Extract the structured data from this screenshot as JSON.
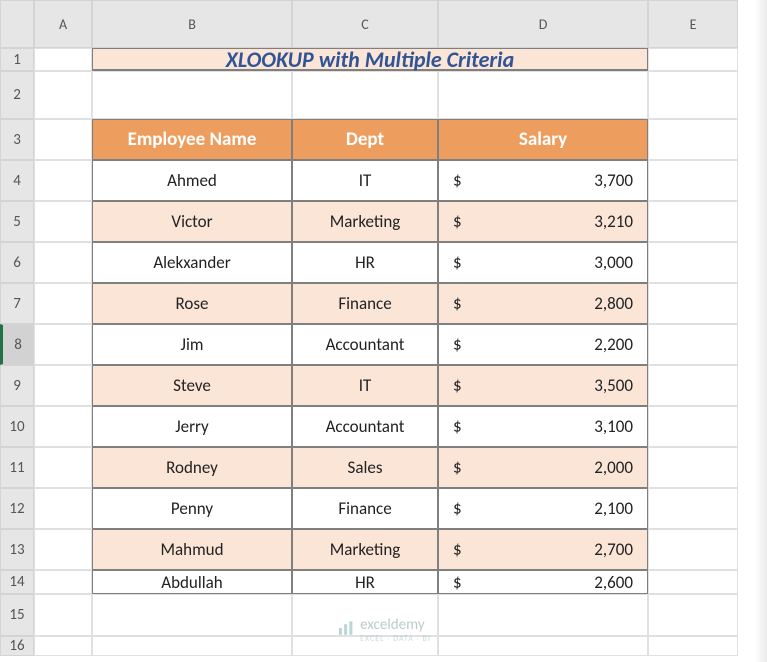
{
  "columns": [
    "A",
    "B",
    "C",
    "D",
    "E"
  ],
  "row_numbers": [
    1,
    2,
    3,
    4,
    5,
    6,
    7,
    8,
    9,
    10,
    11,
    12,
    13,
    14,
    15,
    16
  ],
  "selected_row": 8,
  "title": "XLOOKUP with Multiple Criteria",
  "headers": {
    "name": "Employee Name",
    "dept": "Dept",
    "salary": "Salary"
  },
  "currency": "$",
  "chart_data": {
    "type": "table",
    "columns": [
      "Employee Name",
      "Dept",
      "Salary"
    ],
    "rows": [
      {
        "name": "Ahmed",
        "dept": "IT",
        "salary": 3700,
        "salary_fmt": "3,700"
      },
      {
        "name": "Victor",
        "dept": "Marketing",
        "salary": 3210,
        "salary_fmt": "3,210"
      },
      {
        "name": "Alekxander",
        "dept": "HR",
        "salary": 3000,
        "salary_fmt": "3,000"
      },
      {
        "name": "Rose",
        "dept": "Finance",
        "salary": 2800,
        "salary_fmt": "2,800"
      },
      {
        "name": "Jim",
        "dept": "Accountant",
        "salary": 2200,
        "salary_fmt": "2,200"
      },
      {
        "name": "Steve",
        "dept": "IT",
        "salary": 3500,
        "salary_fmt": "3,500"
      },
      {
        "name": "Jerry",
        "dept": "Accountant",
        "salary": 3100,
        "salary_fmt": "3,100"
      },
      {
        "name": "Rodney",
        "dept": "Sales",
        "salary": 2000,
        "salary_fmt": "2,000"
      },
      {
        "name": "Penny",
        "dept": "Finance",
        "salary": 2100,
        "salary_fmt": "2,100"
      },
      {
        "name": "Mahmud",
        "dept": "Marketing",
        "salary": 2700,
        "salary_fmt": "2,700"
      },
      {
        "name": "Abdullah",
        "dept": "HR",
        "salary": 2600,
        "salary_fmt": "2,600"
      }
    ]
  },
  "watermark": {
    "brand": "exceldemy",
    "sub": "EXCEL · DATA · BI"
  }
}
